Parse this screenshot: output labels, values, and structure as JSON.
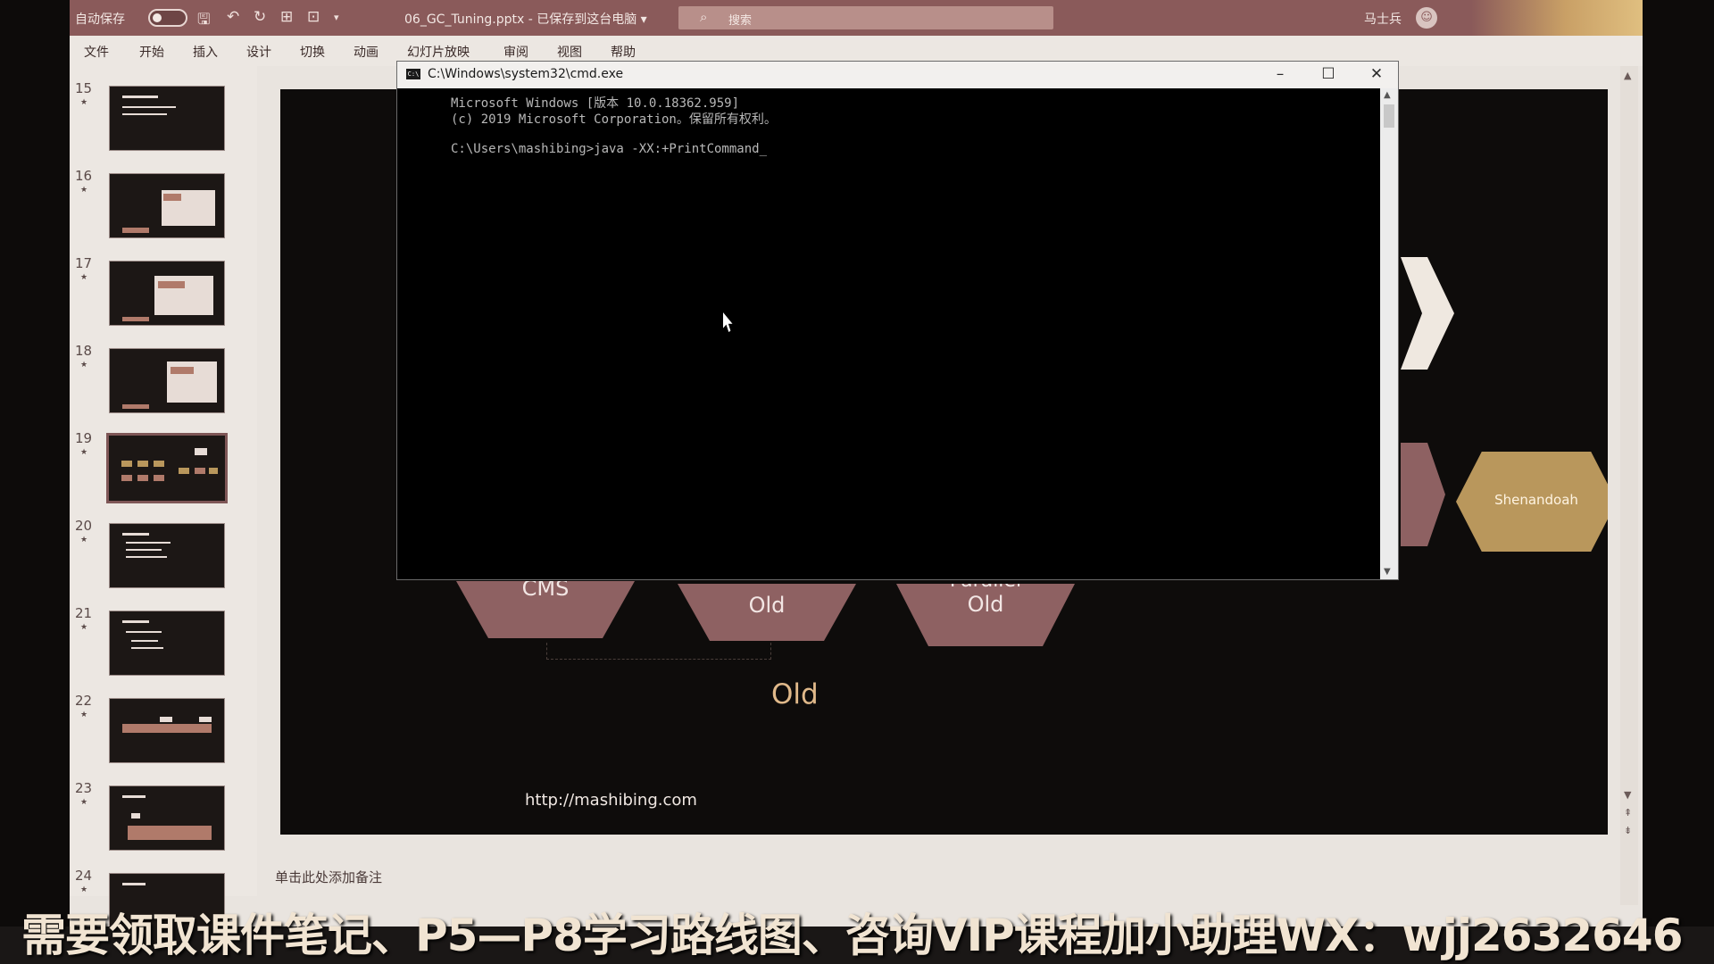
{
  "ppt": {
    "autosave_label": "自动保存",
    "filename": "06_GC_Tuning.pptx - 已保存到这台电脑 ▾",
    "search_placeholder": "搜索",
    "user_name": "马士兵",
    "ribbon_tabs": [
      "文件",
      "开始",
      "插入",
      "设计",
      "切换",
      "动画",
      "幻灯片放映",
      "审阅",
      "视图",
      "帮助"
    ]
  },
  "thumbnails": [
    {
      "num": "15",
      "star": "★"
    },
    {
      "num": "16",
      "star": "★"
    },
    {
      "num": "17",
      "star": "★"
    },
    {
      "num": "18",
      "star": "★"
    },
    {
      "num": "19",
      "star": "★",
      "selected": true
    },
    {
      "num": "20",
      "star": "★"
    },
    {
      "num": "21",
      "star": "★"
    },
    {
      "num": "22",
      "star": "★"
    },
    {
      "num": "23",
      "star": "★"
    },
    {
      "num": "24",
      "star": "★"
    }
  ],
  "slide": {
    "shapes": {
      "cms": "CMS",
      "old": "Old",
      "parallel_old_line1": "Parallel",
      "parallel_old_line2": "Old",
      "shenandoah": "Shenandoah"
    },
    "old_label": "Old",
    "url": "http://mashibing.com"
  },
  "notes_placeholder": "单击此处添加备注",
  "cmd": {
    "title": "C:\\Windows\\system32\\cmd.exe",
    "icon_text": "C:\\",
    "lines": [
      "Microsoft Windows [版本 10.0.18362.959]",
      "(c) 2019 Microsoft Corporation。保留所有权利。",
      "",
      "C:\\Users\\mashibing>java -XX:+PrintCommand_"
    ]
  },
  "watermark": "需要领取课件笔记、P5—P8学习路线图、咨询VIP课程加小助理WX：wjj2632646",
  "colors": {
    "titlebar": "#8a5a5a",
    "shape_rose": "#8e6162",
    "shape_gold": "#b9975c",
    "old_label": "#e0b98a"
  }
}
